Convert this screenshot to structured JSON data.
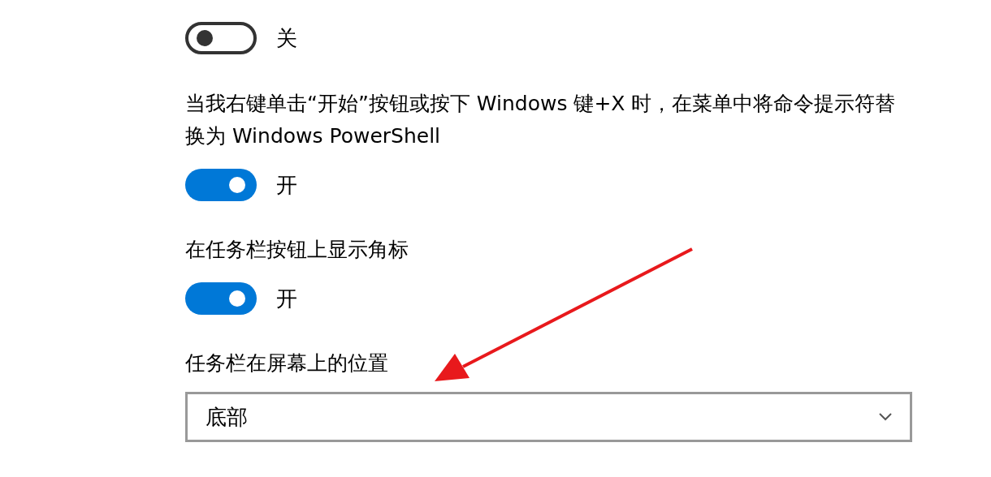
{
  "settings": [
    {
      "kind": "toggle",
      "on": false,
      "state_label": "关"
    },
    {
      "kind": "toggle",
      "label": "当我右键单击“开始”按钮或按下 Windows 键+X 时，在菜单中将命令提示符替换为 Windows PowerShell",
      "on": true,
      "state_label": "开"
    },
    {
      "kind": "toggle",
      "label": "在任务栏按钮上显示角标",
      "on": true,
      "state_label": "开"
    },
    {
      "kind": "dropdown",
      "label": "任务栏在屏幕上的位置",
      "value": "底部"
    }
  ]
}
